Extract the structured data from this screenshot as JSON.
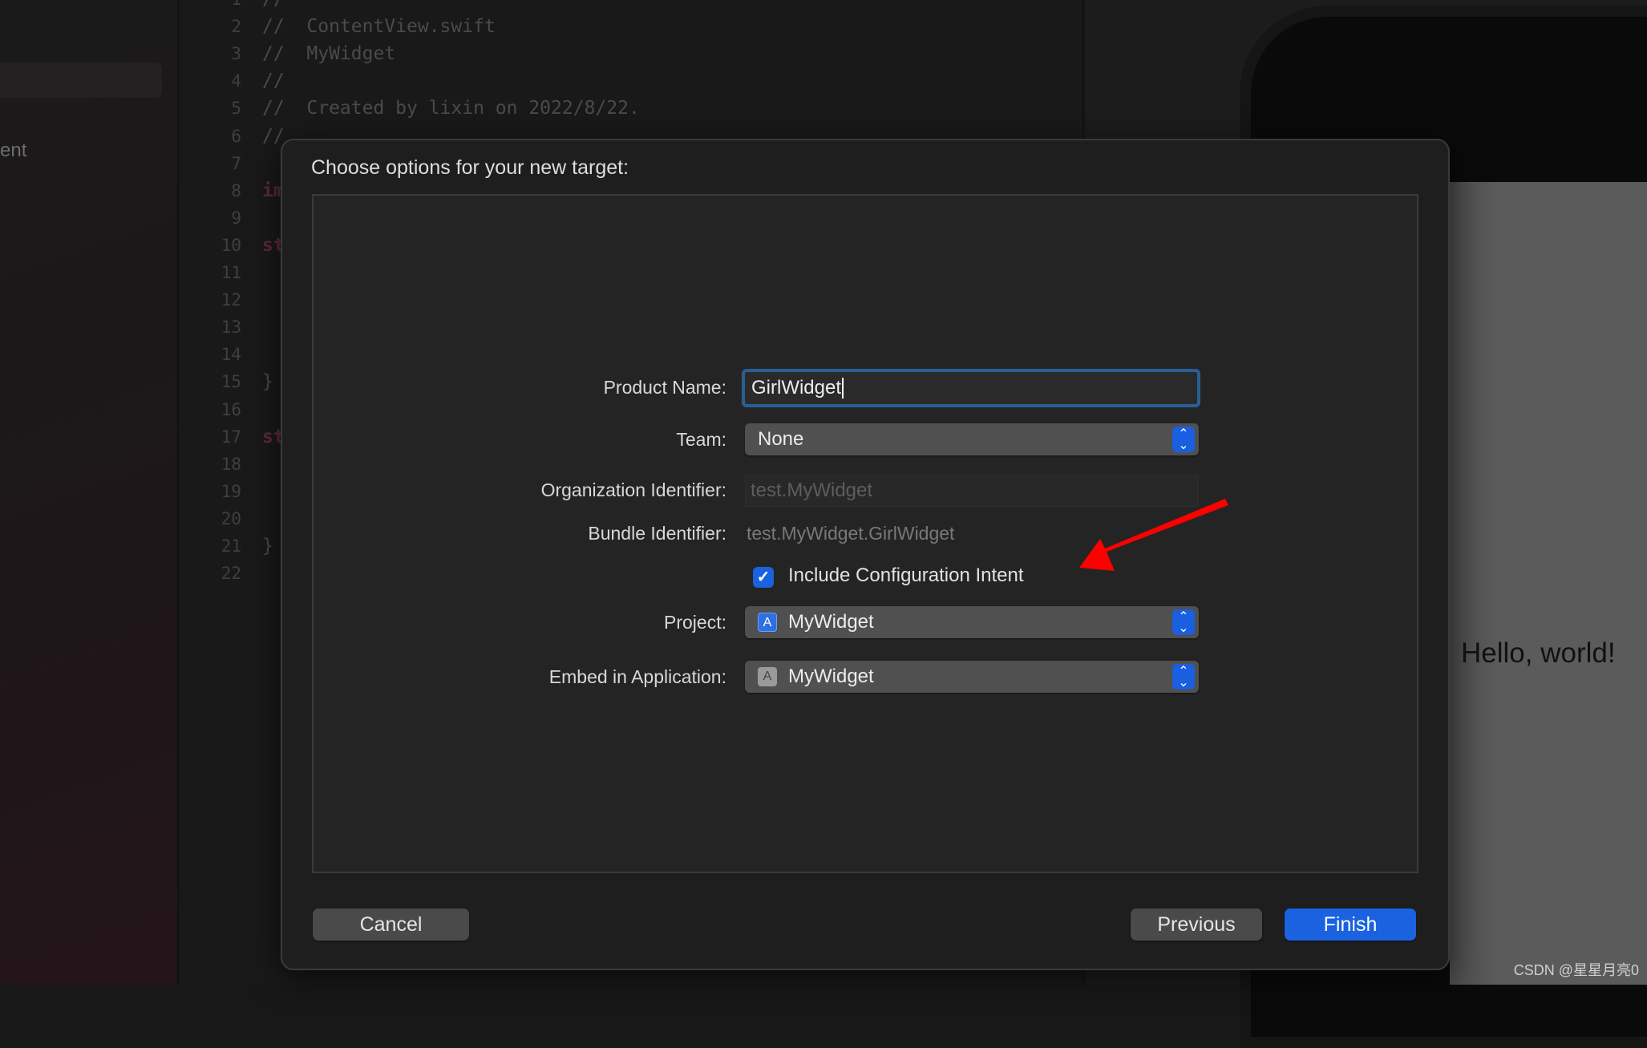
{
  "sidebar": {
    "partial_text": "ent"
  },
  "editor": {
    "line_numbers": [
      "1",
      "2",
      "3",
      "4",
      "5",
      "6",
      "7",
      "8",
      "9",
      "10",
      "11",
      "12",
      "13",
      "14",
      "15",
      "16",
      "17",
      "18",
      "19",
      "20",
      "21",
      "22"
    ],
    "lines": [
      {
        "n": 1,
        "text": "//"
      },
      {
        "n": 2,
        "text": "//  ContentView.swift"
      },
      {
        "n": 3,
        "text": "//  MyWidget"
      },
      {
        "n": 4,
        "text": "//"
      },
      {
        "n": 5,
        "text": "//  Created by lixin on 2022/8/22."
      },
      {
        "n": 6,
        "text": "//"
      },
      {
        "n": 8,
        "text": "im",
        "keyword": true
      },
      {
        "n": 10,
        "text": "st",
        "keyword": true
      },
      {
        "n": 15,
        "text": "}"
      },
      {
        "n": 17,
        "text": "st",
        "keyword": true
      },
      {
        "n": 21,
        "text": "}"
      }
    ]
  },
  "preview": {
    "text": "Hello, world!"
  },
  "dialog": {
    "title": "Choose options for your new target:",
    "product_name": {
      "label": "Product Name:",
      "value": "GirlWidget"
    },
    "team": {
      "label": "Team:",
      "value": "None"
    },
    "org_id": {
      "label": "Organization Identifier:",
      "value": "test.MyWidget"
    },
    "bundle_id": {
      "label": "Bundle Identifier:",
      "value": "test.MyWidget.GirlWidget"
    },
    "include_intent": {
      "label": "Include Configuration Intent",
      "checked": true
    },
    "project": {
      "label": "Project:",
      "value": "MyWidget",
      "icon": "app-store-icon"
    },
    "embed": {
      "label": "Embed in Application:",
      "value": "MyWidget",
      "icon": "app-store-icon"
    },
    "buttons": {
      "cancel": "Cancel",
      "previous": "Previous",
      "finish": "Finish"
    }
  },
  "colors": {
    "accent": "#1a62e0",
    "focus_ring": "#2a5f94",
    "annotation_arrow": "#ff0000"
  },
  "watermark": "CSDN @星星月亮0"
}
